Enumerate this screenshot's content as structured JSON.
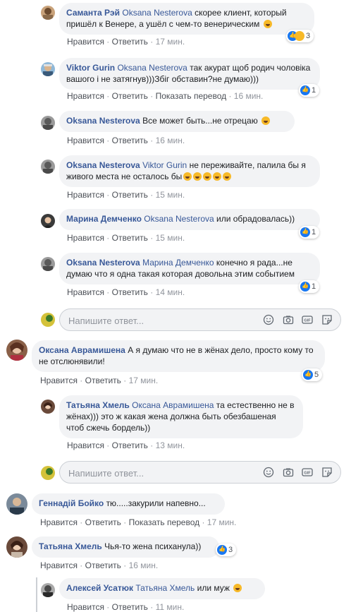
{
  "actions": {
    "like": "Нравится",
    "reply": "Ответить",
    "translate": "Показать перевод",
    "sep": " · "
  },
  "reply_placeholder": "Напишите ответ...",
  "comments": [
    {
      "author": "Саманта Рэй",
      "mention": "Oksana Nesterova",
      "text": "скорее клиент, который пришёл к Венере, а ушёл с чем-то венерическим",
      "time": "17 мин.",
      "reactions": "3"
    },
    {
      "author": "Viktor Gurin",
      "mention": "Oksana Nesterova",
      "text": "так акурат щоб родич чоловіка вашого і не затягнув)))Збіг обставин?не думаю)))",
      "time": "16 мин.",
      "reactions": "1"
    },
    {
      "author": "Oksana Nesterova",
      "mention": "",
      "text": "Все может быть...не отрецаю",
      "time": "16 мин.",
      "reactions": ""
    },
    {
      "author": "Oksana Nesterova",
      "mention": "Viktor Gurin",
      "text": "не переживайте, палила бы я живого места не осталось бы",
      "time": "15 мин.",
      "reactions": ""
    },
    {
      "author": "Марина Демченко",
      "mention": "Oksana Nesterova",
      "text": "или обрадовалась))",
      "time": "15 мин.",
      "reactions": "1"
    },
    {
      "author": "Oksana Nesterova",
      "mention": "Марина Демченко",
      "text": "конечно я рада...не думаю что я одна такая которая довольна этим событием",
      "time": "14 мин.",
      "reactions": "1"
    },
    {
      "author": "Оксана Аврамишена",
      "mention": "",
      "text": "А я думаю что не в жёнах дело, просто кому то не отслюнявили!",
      "time": "17 мин.",
      "reactions": "5"
    },
    {
      "author": "Татьяна Хмель",
      "mention": "Оксана Аврамишена",
      "text": "та естественно не в жёнах))) это ж какая жена должна быть обезбашеная чтоб сжечь бордель))",
      "time": "13 мин.",
      "reactions": ""
    },
    {
      "author": "Геннадій Бойко",
      "mention": "",
      "text": "тю.....закурили напевно...",
      "time": "17 мин.",
      "reactions": ""
    },
    {
      "author": "Татьяна Хмель",
      "mention": "",
      "text": "Чья-то жена психанула))",
      "time": "16 мин.",
      "reactions": "3"
    },
    {
      "author": "Алексей Усатюк",
      "mention": "Татьяна Хмель",
      "text": "или муж",
      "time": "11 мин.",
      "reactions": ""
    }
  ]
}
